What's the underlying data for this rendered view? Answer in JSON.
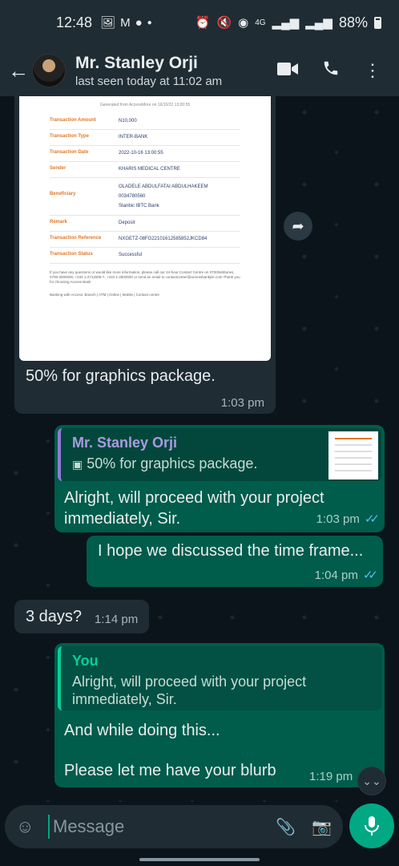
{
  "status_bar": {
    "time": "12:48",
    "left_icons": [
      "image-icon",
      "gmail-icon",
      "account-icon",
      "dot-icon"
    ],
    "right_icons": [
      "alarm-icon",
      "mute-icon",
      "hotspot-icon",
      "4g-icon",
      "signal-icon",
      "signal-icon"
    ],
    "battery": "88%"
  },
  "header": {
    "contact_name": "Mr. Stanley Orji",
    "last_seen": "last seen today at 11:02 am"
  },
  "receipt": {
    "generated": "Generated from AccessMore on 16/10/22 13:00:55",
    "rows": [
      {
        "key": "Transaction Amount",
        "value": "N10,000"
      },
      {
        "key": "Transaction Type",
        "value": "INTER-BANK"
      },
      {
        "key": "Transaction Date",
        "value": "2022-10-16 13:00:55"
      },
      {
        "key": "Sender",
        "value": "KHARIS MEDICAL CENTRE"
      },
      {
        "key": "Beneficiary",
        "value": "OLADELE ABDULFATAI ABDULHAKEEM\n0034780560\nStanbic IBTC Bank"
      },
      {
        "key": "Remark",
        "value": "Deposit"
      },
      {
        "key": "Transaction Reference",
        "value": "NXGETZ-08FG22101612585852JKCD84"
      },
      {
        "key": "Transaction Status",
        "value": "Successful"
      }
    ],
    "footer": "If you have any questions or would like more information, please call our 24-hour Contact Centre on 07000ahttunes, 0700-3000000, +234 1-2712005-7, +234 1-2802500 or send an email to contactcenter@accessbankplc.com Thank you for choosing Access Bank",
    "footer2": "Banking with Access: Branch | ATM | Online | Mobile | Contact centre"
  },
  "messages": {
    "m1": {
      "text": "50% for graphics package.",
      "time": "1:03 pm"
    },
    "m2": {
      "quote_name": "Mr. Stanley Orji",
      "quote_text": "50% for graphics package.",
      "text": "Alright, will proceed with your project immediately,  Sir.",
      "time": "1:03 pm"
    },
    "m3": {
      "text": "I hope we discussed the time frame...",
      "time": "1:04 pm"
    },
    "m4": {
      "text": "3 days?",
      "time": "1:14 pm"
    },
    "m5": {
      "quote_name": "You",
      "quote_text": "Alright, will proceed with your project immediately,  Sir.",
      "text_line1": "And while doing this...",
      "text_line2": "Please let me have your blurb",
      "time": "1:19 pm"
    }
  },
  "composer": {
    "placeholder": "Message"
  },
  "colors": {
    "header": "#1f2c34",
    "background": "#0b141a",
    "outgoing_bubble": "#005c4b",
    "incoming_bubble": "#1f2c34",
    "accent": "#00a884",
    "read_ticks": "#53bdeb"
  }
}
